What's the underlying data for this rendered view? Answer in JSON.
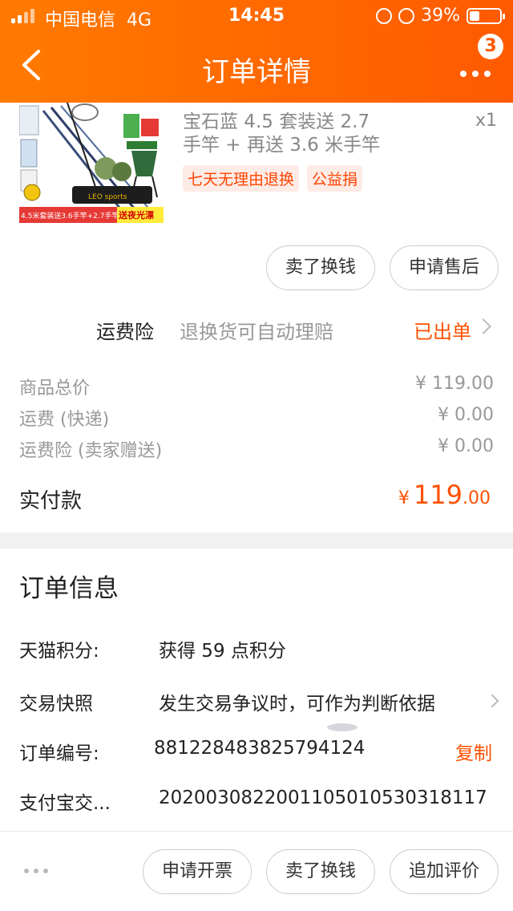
{
  "status_bar": {
    "carrier": "中国电信",
    "network": "4G",
    "time": "14:45",
    "battery": "39%"
  },
  "header": {
    "title": "订单详情",
    "badge_count": "3",
    "back_icon": "chevron-left-icon",
    "more_icon": "more-horizontal-icon"
  },
  "product": {
    "name": "宝石蓝 4.5 套装送 2.7 手竿 + 再送 3.6 米手竿",
    "quantity": "x1",
    "tags": [
      "七天无理由退换",
      "公益捐"
    ],
    "image_caption_left": "4.5米套装送3.6手竿+2.7手竿",
    "image_caption_right": "送夜光漂",
    "image_brand": "LEO sports"
  },
  "actions": {
    "sell_label": "卖了换钱",
    "aftersale_label": "申请售后"
  },
  "insurance": {
    "label": "运费险",
    "desc": "退换货可自动理赔",
    "status": "已出单"
  },
  "prices": [
    {
      "label": "商品总价",
      "value": "¥ 119.00"
    },
    {
      "label": "运费 (快递)",
      "value": "¥ 0.00"
    },
    {
      "label": "运费险 (卖家赠送)",
      "value": "¥ 0.00"
    }
  ],
  "paid": {
    "label": "实付款",
    "currency": "¥",
    "integer": "119",
    "decimal": ".00"
  },
  "order_info": {
    "title": "订单信息",
    "points_label": "天猫积分:",
    "points_value": "获得 59 点积分",
    "snapshot_label": "交易快照",
    "snapshot_value": "发生交易争议时，可作为判断依据",
    "order_no_label": "订单编号:",
    "order_no_value": "881228483825794124",
    "copy_label": "复制",
    "alipay_label": "支付宝交...",
    "alipay_value": "2020030822001105010530318117"
  },
  "bottom_bar": {
    "invoice_label": "申请开票",
    "sell_label": "卖了换钱",
    "review_label": "追加评价"
  },
  "colors": {
    "brand": "#ff5a00",
    "price": "#ff5000",
    "tag_bg": "#fdebe6"
  }
}
